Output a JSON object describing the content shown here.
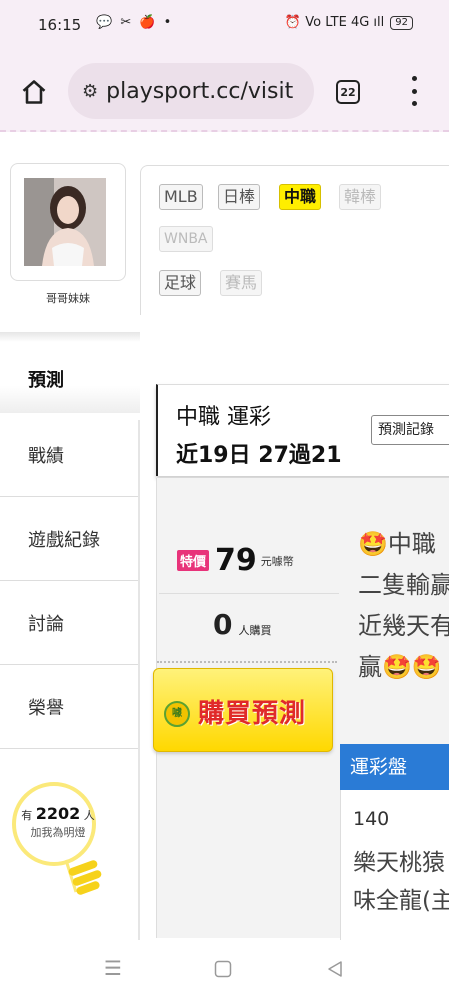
{
  "status": {
    "time": "16:15",
    "notifications": "💬 ✂ 🍎 •",
    "signal": "⏰ Vo LTE 4G ıll",
    "battery": "92"
  },
  "browser": {
    "url": "playsport.cc/visit",
    "tab_count": "22"
  },
  "profile": {
    "name": "哥哥妹妹"
  },
  "leagues": [
    {
      "label": "MLB"
    },
    {
      "label": "日棒"
    },
    {
      "label": "中職"
    },
    {
      "label": "韓棒"
    },
    {
      "label": "WNBA"
    },
    {
      "label": "足球"
    },
    {
      "label": "賽馬"
    }
  ],
  "left_menu": [
    {
      "label": "預測"
    },
    {
      "label": "戰績"
    },
    {
      "label": "遊戲紀錄"
    },
    {
      "label": "討論"
    },
    {
      "label": "榮譽"
    }
  ],
  "fans": {
    "prefix": "有",
    "count": "2202",
    "suffix": "人",
    "sub": "加我為明燈"
  },
  "prediction": {
    "title": "中職 運彩",
    "record": "近19日 27過21",
    "record_button": "預測記錄"
  },
  "offer": {
    "special": "特價",
    "price": "79",
    "unit": "元噱幣",
    "buyers": "0",
    "buyers_unit": "人購買",
    "buy_button": "購買預測",
    "coin": "噱"
  },
  "description": {
    "line1": "🤩中職",
    "line2": "二隻輸贏",
    "line3": "近幾天有",
    "line4": "贏🤩🤩"
  },
  "odds": {
    "header": "運彩盤",
    "number": "140",
    "team_line1": "樂天桃猿",
    "team_line2": "味全龍(主"
  }
}
